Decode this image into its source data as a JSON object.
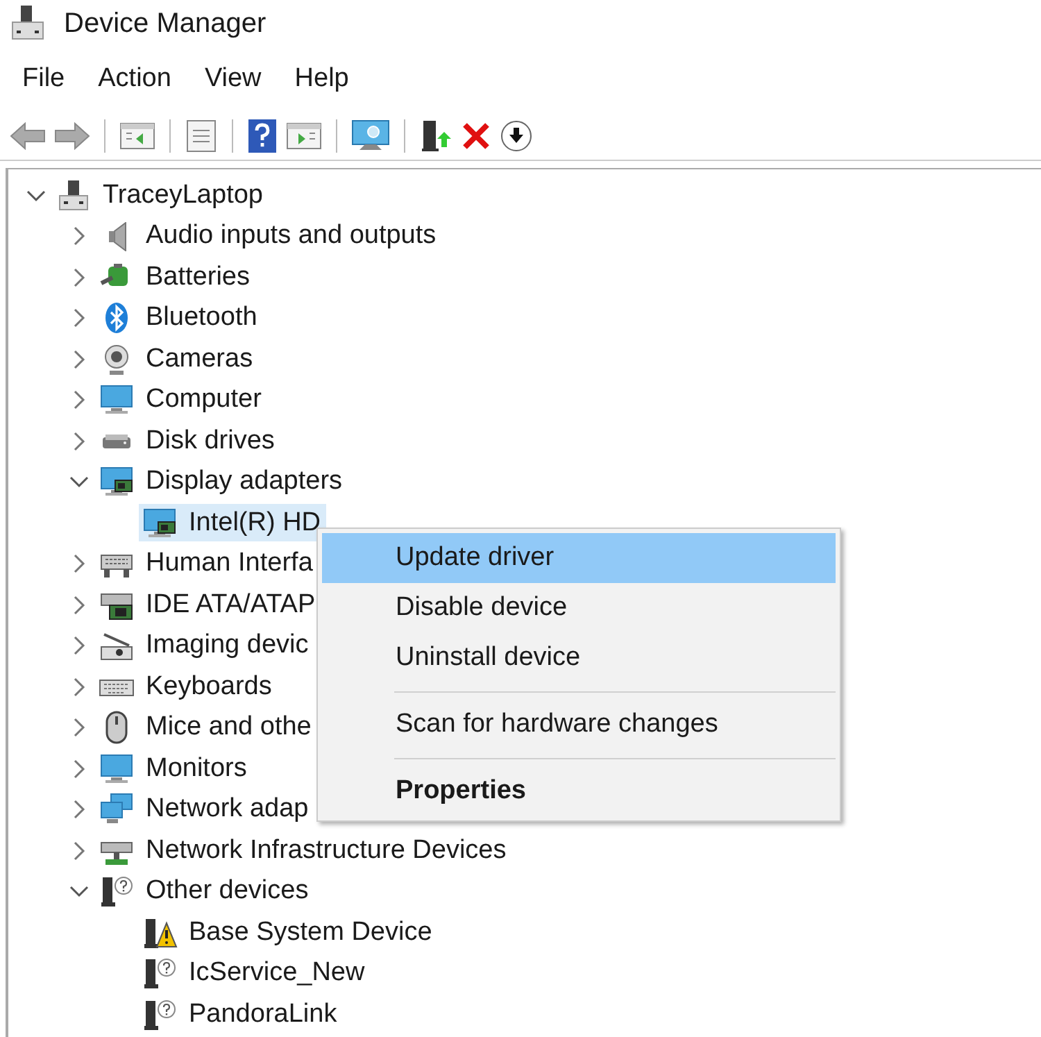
{
  "window": {
    "title": "Device Manager"
  },
  "menu_bar": [
    "File",
    "Action",
    "View",
    "Help"
  ],
  "tree": [
    {
      "label": "TraceyLaptop",
      "expanded": true,
      "selected": false,
      "children": [
        {
          "label": "Audio inputs and outputs",
          "expanded": false,
          "selected": false
        },
        {
          "label": "Batteries",
          "expanded": false,
          "selected": false
        },
        {
          "label": "Bluetooth",
          "expanded": false,
          "selected": false
        },
        {
          "label": "Cameras",
          "expanded": false,
          "selected": false
        },
        {
          "label": "Computer",
          "expanded": false,
          "selected": false
        },
        {
          "label": "Disk drives",
          "expanded": false,
          "selected": false
        },
        {
          "label": "Display adapters",
          "expanded": true,
          "selected": false,
          "children": [
            {
              "label": "Intel(R) HD",
              "selected": true
            }
          ]
        },
        {
          "label": "Human Interfa",
          "expanded": false,
          "selected": false
        },
        {
          "label": "IDE ATA/ATAP",
          "expanded": false,
          "selected": false
        },
        {
          "label": "Imaging devic",
          "expanded": false,
          "selected": false
        },
        {
          "label": "Keyboards",
          "expanded": false,
          "selected": false
        },
        {
          "label": "Mice and othe",
          "expanded": false,
          "selected": false
        },
        {
          "label": "Monitors",
          "expanded": false,
          "selected": false
        },
        {
          "label": "Network adap",
          "expanded": false,
          "selected": false
        },
        {
          "label": "Network Infrastructure Devices",
          "expanded": false,
          "selected": false
        },
        {
          "label": "Other devices",
          "expanded": true,
          "selected": false,
          "children": [
            {
              "label": "Base System Device",
              "selected": false
            },
            {
              "label": "IcService_New",
              "selected": false
            },
            {
              "label": "PandoraLink",
              "selected": false
            }
          ]
        }
      ]
    }
  ],
  "context_menu": {
    "items": [
      {
        "kind": "item",
        "label": "Update driver",
        "selected": true,
        "default": false
      },
      {
        "kind": "item",
        "label": "Disable device",
        "selected": false,
        "default": false
      },
      {
        "kind": "item",
        "label": "Uninstall device",
        "selected": false,
        "default": false
      },
      {
        "kind": "separator"
      },
      {
        "kind": "item",
        "label": "Scan for hardware changes",
        "selected": false,
        "default": false
      },
      {
        "kind": "separator"
      },
      {
        "kind": "item",
        "label": "Properties",
        "selected": false,
        "default": true
      }
    ]
  }
}
